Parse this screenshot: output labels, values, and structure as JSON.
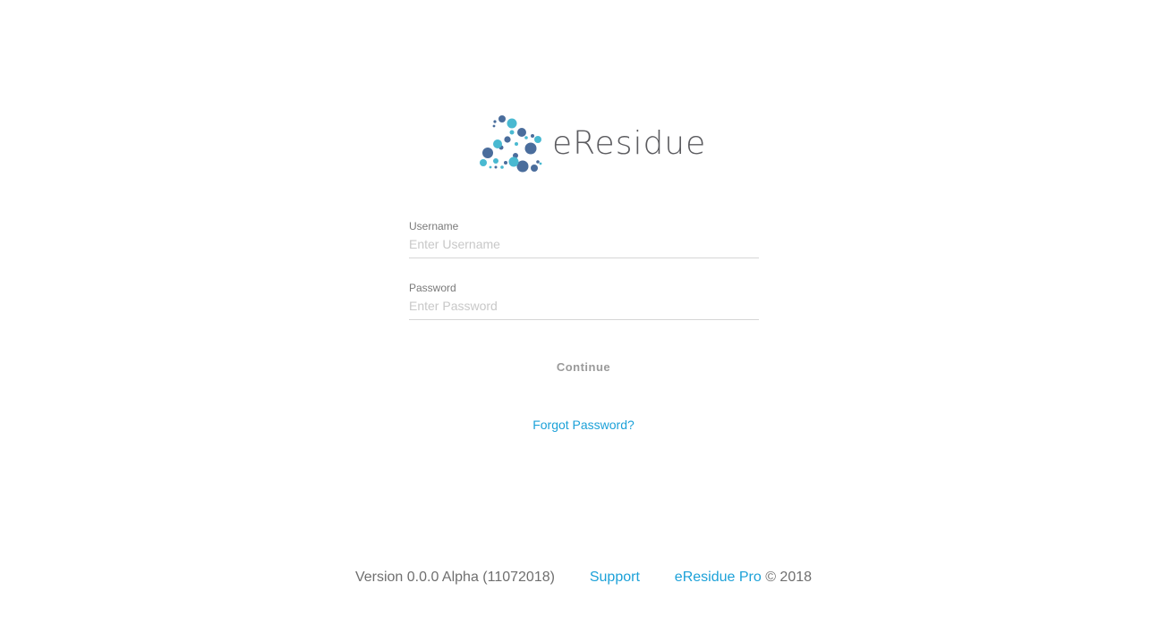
{
  "logo": {
    "brand_name": "eResidue",
    "colors": {
      "dark_blue": "#4a6d9c",
      "light_blue": "#49b9d1",
      "text": "#5b5b5f"
    }
  },
  "form": {
    "username": {
      "label": "Username",
      "placeholder": "Enter Username",
      "value": ""
    },
    "password": {
      "label": "Password",
      "placeholder": "Enter Password",
      "value": ""
    },
    "continue_label": "Continue",
    "forgot_password_label": "Forgot Password?"
  },
  "footer": {
    "version": "Version 0.0.0 Alpha (11072018)",
    "support_label": "Support",
    "product_link": "eResidue Pro",
    "copyright": " © 2018"
  },
  "colors": {
    "link": "#1ca1d8",
    "muted_text": "#6f6f6f",
    "divider": "#d6d6d6"
  }
}
